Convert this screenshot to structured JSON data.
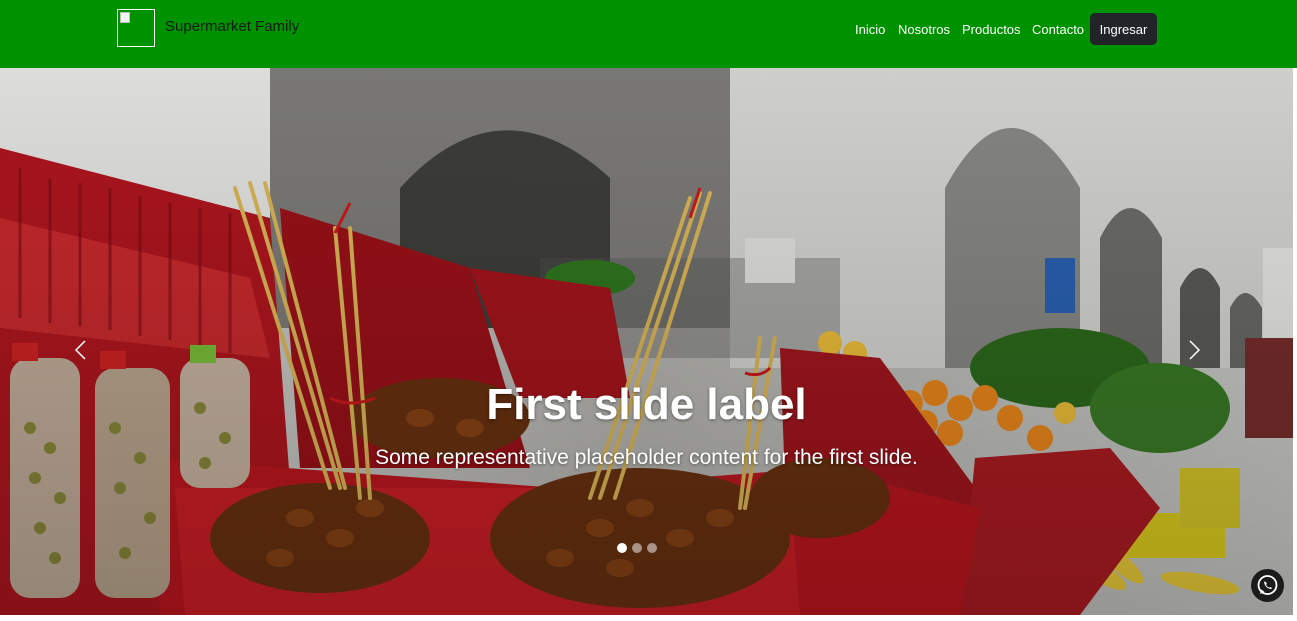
{
  "navbar": {
    "brand": "Supermarket Family",
    "links": [
      "Inicio",
      "Nosotros",
      "Productos",
      "Contacto"
    ],
    "login_label": "Ingresar",
    "color": "#009200"
  },
  "carousel": {
    "title": "First slide label",
    "text": "Some representative placeholder content for the first slide.",
    "slides_count": 3,
    "active_slide": 1
  },
  "icons": {
    "logo": "broken-image-icon",
    "prev": "chevron-left-icon",
    "next": "chevron-right-icon",
    "whatsapp": "whatsapp-icon"
  }
}
